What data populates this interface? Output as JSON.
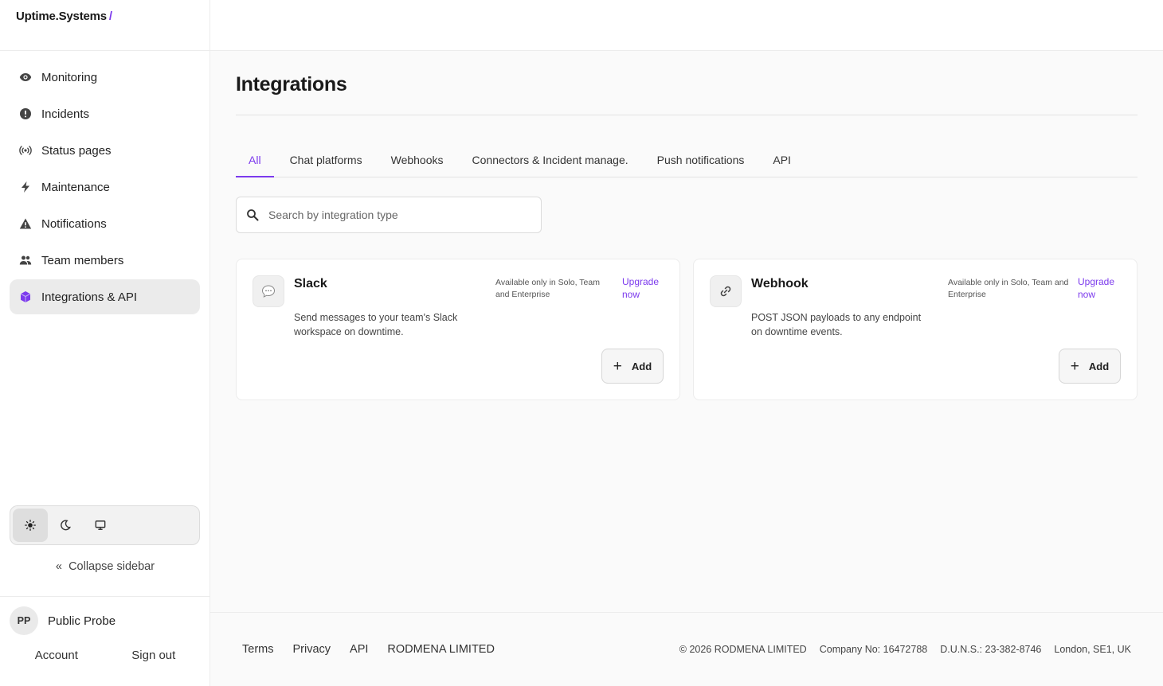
{
  "brand": {
    "name": "Uptime.Systems",
    "slash": "/"
  },
  "sidebar": {
    "items": [
      {
        "label": "Monitoring",
        "icon": "eye-icon"
      },
      {
        "label": "Incidents",
        "icon": "alert-circle-icon"
      },
      {
        "label": "Status pages",
        "icon": "broadcast-icon"
      },
      {
        "label": "Maintenance",
        "icon": "lightning-icon"
      },
      {
        "label": "Notifications",
        "icon": "warning-triangle-icon"
      },
      {
        "label": "Team members",
        "icon": "users-icon"
      },
      {
        "label": "Integrations & API",
        "icon": "cube-icon",
        "active": true
      }
    ],
    "theme": {
      "options": [
        "sun-icon",
        "moon-icon",
        "monitor-icon"
      ],
      "active": "light"
    },
    "collapse_label": "Collapse sidebar",
    "collapse_glyph": "«"
  },
  "user": {
    "initials": "PP",
    "name": "Public Probe",
    "account_label": "Account",
    "signout_label": "Sign out"
  },
  "main": {
    "title": "Integrations",
    "tabs": [
      {
        "label": "All",
        "active": true
      },
      {
        "label": "Chat platforms"
      },
      {
        "label": "Webhooks"
      },
      {
        "label": "Connectors & Incident manage."
      },
      {
        "label": "Push notifications"
      },
      {
        "label": "API"
      }
    ],
    "search": {
      "placeholder": "Search by integration type",
      "value": ""
    },
    "cards": [
      {
        "name": "Slack",
        "icon": "chat-bubble-icon",
        "description": "Send messages to your team's Slack workspace on downtime.",
        "availability": "Available only in Solo, Team and Enterprise",
        "upgrade_label": "Upgrade now",
        "add_label": "Add"
      },
      {
        "name": "Webhook",
        "icon": "link-icon",
        "description": "POST JSON payloads to any endpoint on downtime events.",
        "availability": "Available only in Solo, Team and Enterprise",
        "upgrade_label": "Upgrade now",
        "add_label": "Add"
      }
    ]
  },
  "footer": {
    "links": [
      "Terms",
      "Privacy",
      "API",
      "RODMENA LIMITED"
    ],
    "info": [
      "© 2026 RODMENA LIMITED",
      "Company No: 16472788",
      "D.U.N.S.: 23-382-8746",
      "London, SE1, UK"
    ]
  },
  "colors": {
    "accent": "#7c3aed",
    "sidebar_active": "#ebebeb"
  }
}
